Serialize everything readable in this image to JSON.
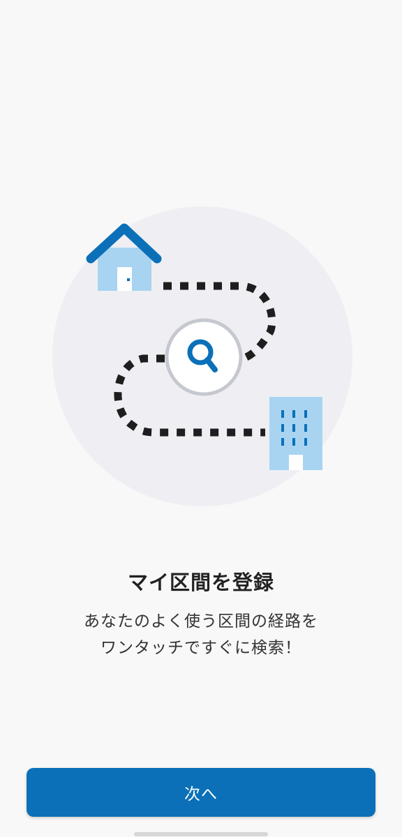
{
  "onboarding": {
    "title": "マイ区間を登録",
    "description_lines": [
      "あなたのよく使う区間の経路を",
      "ワンタッチですぐに検索！"
    ],
    "next_button_label": "次へ"
  },
  "colors": {
    "background": "#f8f8f8",
    "accent_blue": "#0b70b8",
    "light_blue": "#a8d4f2",
    "circle_gray": "#efeff3",
    "route_dots": "#1e1e1e"
  },
  "icons": {
    "home": "house-icon",
    "search": "magnifier-icon",
    "destination": "office-building-icon"
  }
}
